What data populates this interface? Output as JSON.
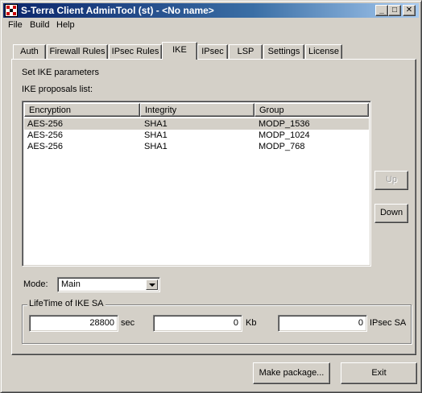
{
  "window": {
    "title": "S-Terra Client AdminTool (st) - <No name>",
    "controls": {
      "minimize": "_",
      "maximize": "□",
      "close": "✕"
    }
  },
  "menu": [
    "File",
    "Build",
    "Help"
  ],
  "tabs": [
    {
      "label": "Auth"
    },
    {
      "label": "Firewall Rules"
    },
    {
      "label": "IPsec Rules"
    },
    {
      "label": "IKE",
      "active": true
    },
    {
      "label": "IPsec"
    },
    {
      "label": "LSP"
    },
    {
      "label": "Settings"
    },
    {
      "label": "License"
    }
  ],
  "panel": {
    "heading": "Set IKE parameters",
    "list_label": "IKE proposals list:",
    "columns": [
      "Encryption",
      "Integrity",
      "Group"
    ],
    "rows": [
      {
        "encryption": "AES-256",
        "integrity": "SHA1",
        "group": "MODP_1536",
        "selected": true
      },
      {
        "encryption": "AES-256",
        "integrity": "SHA1",
        "group": "MODP_1024"
      },
      {
        "encryption": "AES-256",
        "integrity": "SHA1",
        "group": "MODP_768"
      }
    ],
    "up_label": "Up",
    "down_label": "Down",
    "mode_label": "Mode:",
    "mode_value": "Main",
    "lifetime": {
      "title": "LifeTime of IKE SA",
      "sec_value": "28800",
      "sec_unit": "sec",
      "kb_value": "0",
      "kb_unit": "Kb",
      "ipsec_value": "0",
      "ipsec_unit": "IPsec SA"
    }
  },
  "footer": {
    "make_package_label": "Make package...",
    "exit_label": "Exit"
  }
}
